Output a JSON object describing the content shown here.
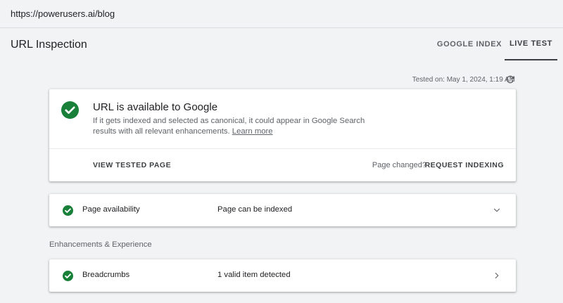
{
  "browser": {
    "url": "https://powerusers.ai/blog"
  },
  "header": {
    "title": "URL Inspection",
    "tabs": [
      {
        "label": "GOOGLE INDEX",
        "active": false
      },
      {
        "label": "LIVE TEST",
        "active": true
      }
    ]
  },
  "test_info": {
    "tested_on": "Tested on: May 1, 2024, 1:19 AM",
    "refresh_icon": "refresh-icon"
  },
  "status": {
    "icon": "check-circle-icon",
    "title": "URL is available to Google",
    "description": "If it gets indexed and selected as canonical, it could appear in Google Search results with all relevant enhancements.",
    "learn_more": "Learn more",
    "view_tested_page": "VIEW TESTED PAGE",
    "page_changed": "Page changed?",
    "request_indexing": "REQUEST INDEXING"
  },
  "availability": {
    "label": "Page availability",
    "value": "Page can be indexed",
    "icon": "check-circle-icon",
    "chevron": "chevron-down-icon"
  },
  "enhancements": {
    "section_label": "Enhancements & Experience",
    "items": [
      {
        "label": "Breadcrumbs",
        "value": "1 valid item detected",
        "icon": "check-circle-icon",
        "chevron": "chevron-right-icon"
      }
    ]
  },
  "colors": {
    "success": "#188038",
    "background": "#f1f3f4",
    "text": "#202124",
    "muted": "#5f6368"
  }
}
